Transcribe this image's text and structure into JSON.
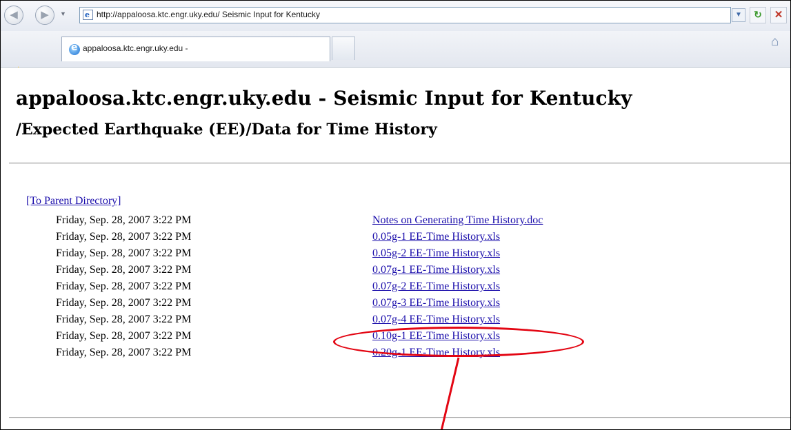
{
  "browser": {
    "url": "http://appaloosa.ktc.engr.uky.edu/ Seismic Input for Kentucky",
    "tab_label": "appaloosa.ktc.engr.uky.edu -",
    "icons": {
      "back": "back-arrow-icon",
      "forward": "forward-arrow-icon",
      "page": "page-icon",
      "refresh": "refresh-icon",
      "stop": "stop-icon",
      "favorites": "favorites-star-icon",
      "add_favorites": "add-favorites-icon",
      "home": "home-icon"
    }
  },
  "page": {
    "title": "appaloosa.ktc.engr.uky.edu - Seismic Input for Kentucky",
    "subtitle": "/Expected Earthquake (EE)/Data for Time History",
    "parent_link": "[To Parent Directory]",
    "files": [
      {
        "date": "Friday, Sep. 28, 2007 3:22 PM",
        "name": "Notes on Generating Time History.doc"
      },
      {
        "date": "Friday, Sep. 28, 2007 3:22 PM",
        "name": "0.05g-1 EE-Time History.xls"
      },
      {
        "date": "Friday, Sep. 28, 2007 3:22 PM",
        "name": "0.05g-2 EE-Time History.xls"
      },
      {
        "date": "Friday, Sep. 28, 2007 3:22 PM",
        "name": "0.07g-1 EE-Time History.xls"
      },
      {
        "date": "Friday, Sep. 28, 2007 3:22 PM",
        "name": "0.07g-2 EE-Time History.xls"
      },
      {
        "date": "Friday, Sep. 28, 2007 3:22 PM",
        "name": "0.07g-3 EE-Time History.xls"
      },
      {
        "date": "Friday, Sep. 28, 2007 3:22 PM",
        "name": "0.07g-4 EE-Time History.xls"
      },
      {
        "date": "Friday, Sep. 28, 2007 3:22 PM",
        "name": "0.10g-1 EE-Time History.xls"
      },
      {
        "date": "Friday, Sep. 28, 2007 3:22 PM",
        "name": "0.20g-1 EE-Time History.xls"
      }
    ]
  },
  "annotation": {
    "highlighted_file": "0.10g-1 EE-Time History.xls",
    "color": "#e30613"
  },
  "colors": {
    "link": "#1a0dab",
    "annotation": "#e30613"
  }
}
